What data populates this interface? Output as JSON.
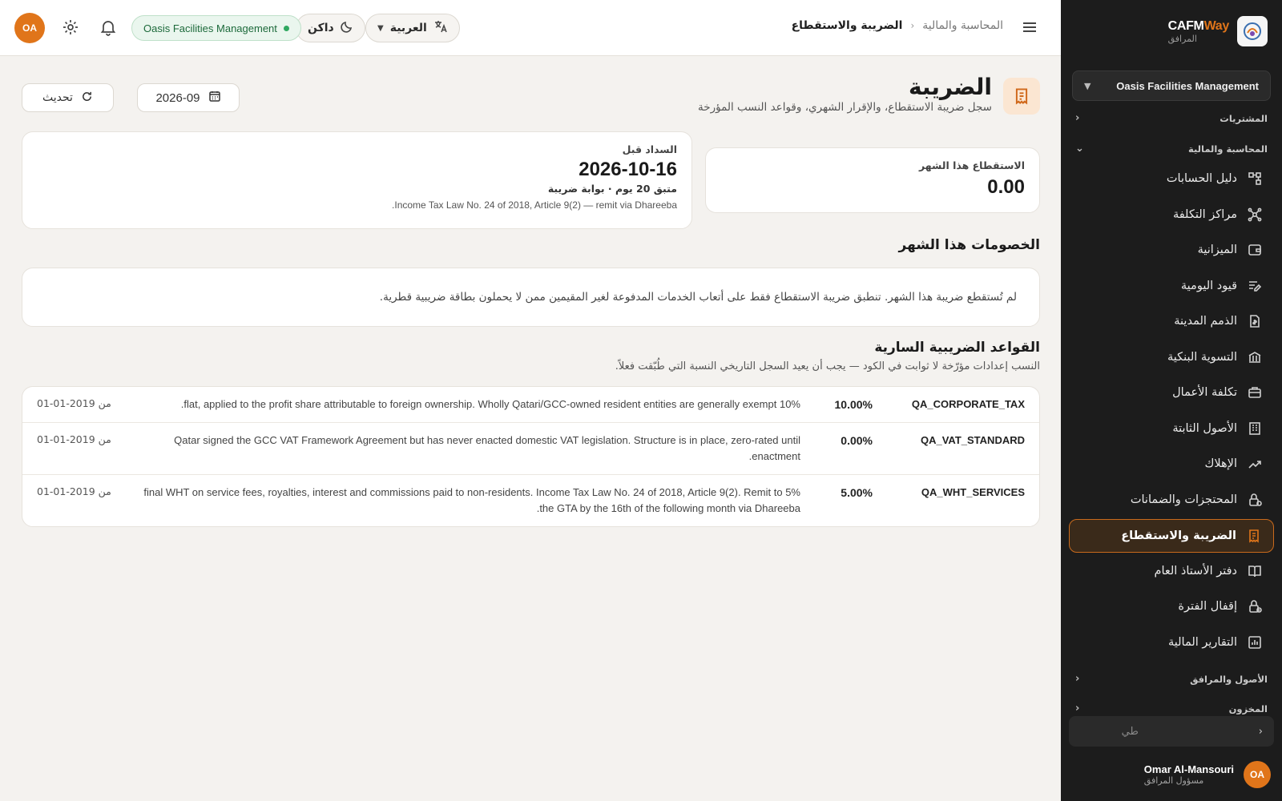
{
  "sidebar": {
    "brand_name_a": "CAFM",
    "brand_name_b": "Way",
    "brand_sub": "المرافق",
    "org_selector": "Oasis Facilities Management",
    "group_procurement": "المشتريات",
    "group_accounting": "المحاسبة والمالية",
    "items": [
      {
        "label": "دليل الحسابات",
        "icon": "chart-of-accounts-icon"
      },
      {
        "label": "مراكز التكلفة",
        "icon": "cost-centers-icon"
      },
      {
        "label": "الميزانية",
        "icon": "wallet-icon"
      },
      {
        "label": "قيود اليومية",
        "icon": "journal-icon"
      },
      {
        "label": "الذمم المدينة",
        "icon": "receivables-icon"
      },
      {
        "label": "التسوية البنكية",
        "icon": "bank-icon"
      },
      {
        "label": "تكلفة الأعمال",
        "icon": "job-cost-icon"
      },
      {
        "label": "الأصول الثابتة",
        "icon": "building-icon"
      },
      {
        "label": "الإهلاك",
        "icon": "trend-icon"
      },
      {
        "label": "المحتجزات والضمانات",
        "icon": "lock-icon"
      },
      {
        "label": "الضريبة والاستقطاع",
        "icon": "receipt-icon"
      },
      {
        "label": "دفتر الأستاذ العام",
        "icon": "book-icon"
      },
      {
        "label": "إقفال الفترة",
        "icon": "period-lock-icon"
      },
      {
        "label": "التقارير المالية",
        "icon": "bar-chart-icon"
      }
    ],
    "group_assets": "الأصول والمرافق",
    "group_inventory": "المخزون",
    "collapse_label": "طي",
    "user_initials": "OA",
    "user_name": "Omar Al-Mansouri",
    "user_role": "مسؤول المرافق"
  },
  "topbar": {
    "breadcrumb_parent": "المحاسبة والمالية",
    "breadcrumb_current": "الضريبة والاستقطاع",
    "language": "العربية",
    "theme": "داكن",
    "org_badge": "Oasis Facilities Management",
    "avatar_initials": "OA"
  },
  "page": {
    "title": "الضريبة",
    "subtitle": "سجل ضريبة الاستقطاع، والإقرار الشهري، وقواعد النسب المؤرخة",
    "period": "2026-09",
    "refresh_label": "تحديث"
  },
  "wht_card": {
    "label": "الاستقطاع هذا الشهر",
    "value": "0.00"
  },
  "due_card": {
    "label": "السداد قبل",
    "date": "2026-10-16",
    "remaining": "متبق 20 يوم · بوابة ضريبة",
    "note": "Income Tax Law No. 24 of 2018, Article 9(2) — remit via Dhareeba."
  },
  "deductions": {
    "title": "الخصومات هذا الشهر",
    "empty": "لم تُستقطع ضريبة هذا الشهر. تنطبق ضريبة الاستقطاع فقط على أتعاب الخدمات المدفوعة لغير المقيمين ممن لا يحملون بطاقة ضريبية قطرية."
  },
  "rules": {
    "title": "القواعد الضريبية السارية",
    "subtitle": "النسب إعدادات مؤرّخة لا ثوابت في الكود — يجب أن يعيد السجل التاريخي النسبة التي طُبّقت فعلاً.",
    "rows": [
      {
        "code": "QA_CORPORATE_TAX",
        "rate": "10.00%",
        "description": "10% flat, applied to the profit share attributable to foreign ownership. Wholly Qatari/GCC-owned resident entities are generally exempt.",
        "from": "من 2019-01-01"
      },
      {
        "code": "QA_VAT_STANDARD",
        "rate": "0.00%",
        "description": "Qatar signed the GCC VAT Framework Agreement but has never enacted domestic VAT legislation. Structure is in place, zero-rated until enactment.",
        "from": "من 2019-01-01"
      },
      {
        "code": "QA_WHT_SERVICES",
        "rate": "5.00%",
        "description": "5% final WHT on service fees, royalties, interest and commissions paid to non-residents. Income Tax Law No. 24 of 2018, Article 9(2). Remit to the GTA by the 16th of the following month via Dhareeba.",
        "from": "من 2019-01-01"
      }
    ]
  },
  "colors": {
    "accent": "#e0751a",
    "sidebar_bg": "#1c1c1c",
    "page_bg": "#f4f2ef",
    "success": "#2fa860"
  }
}
